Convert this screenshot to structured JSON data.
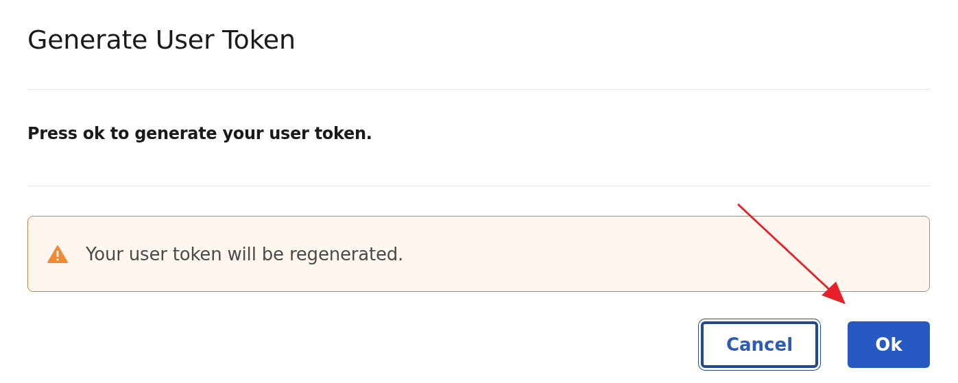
{
  "dialog": {
    "title": "Generate User Token",
    "message": "Press ok to generate your user token.",
    "alert": {
      "kind": "warning",
      "text": "Your user token will be regenerated."
    },
    "buttons": [
      {
        "label": "Cancel",
        "kind": "secondary",
        "focused": true
      },
      {
        "label": "Ok",
        "kind": "primary",
        "focused": false
      }
    ]
  },
  "annotations": [
    {
      "kind": "arrow",
      "color": "#e8202a"
    }
  ]
}
